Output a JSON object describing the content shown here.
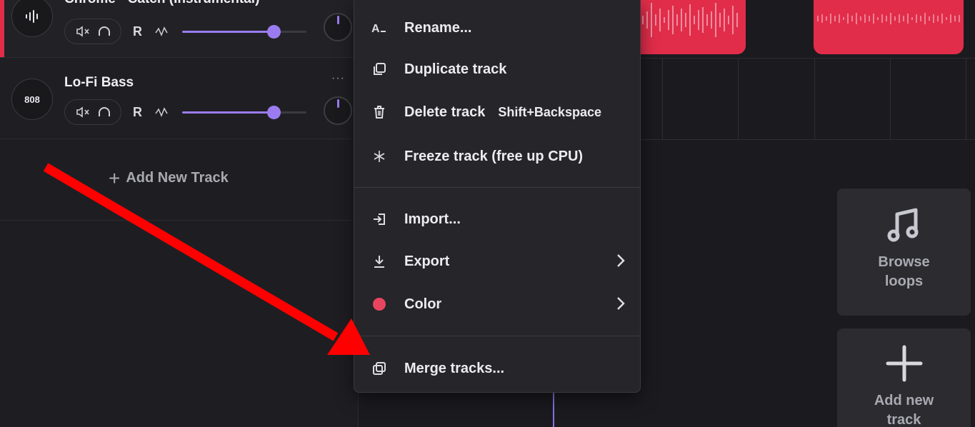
{
  "tracks": [
    {
      "name": "Chrome - Catch (Instrumental)",
      "avatar_icon": "waveform-icon",
      "accent_color": "#e12d4a",
      "record_label": "R",
      "volume_level": 0.74,
      "more_label": "···"
    },
    {
      "name": "Lo-Fi Bass",
      "avatar_label": "808",
      "record_label": "R",
      "volume_level": 0.74,
      "more_label": "···"
    }
  ],
  "add_track": {
    "plus": "+",
    "label": "Add New Track"
  },
  "side_panel": {
    "browse": {
      "icon": "music-note-icon",
      "label": "Browse loops"
    },
    "add_new": {
      "icon": "plus-icon",
      "label": "Add new track"
    }
  },
  "context_menu": {
    "groups": [
      [
        {
          "icon": "rename-icon",
          "label": "Rename..."
        },
        {
          "icon": "duplicate-icon",
          "label": "Duplicate track"
        },
        {
          "icon": "trash-icon",
          "label": "Delete track",
          "shortcut": "Shift+Backspace"
        },
        {
          "icon": "snowflake-icon",
          "label": "Freeze track (free up CPU)"
        }
      ],
      [
        {
          "icon": "import-icon",
          "label": "Import..."
        },
        {
          "icon": "download-icon",
          "label": "Export",
          "submenu": true
        },
        {
          "icon": "color-dot-icon",
          "label": "Color",
          "submenu": true,
          "color": "#e8455f"
        }
      ],
      [
        {
          "icon": "merge-icon",
          "label": "Merge tracks..."
        }
      ]
    ]
  },
  "colors": {
    "accent_purple": "#9b7cf0",
    "clip_red": "#e12d4a",
    "annotation_arrow": "#ff0000"
  }
}
